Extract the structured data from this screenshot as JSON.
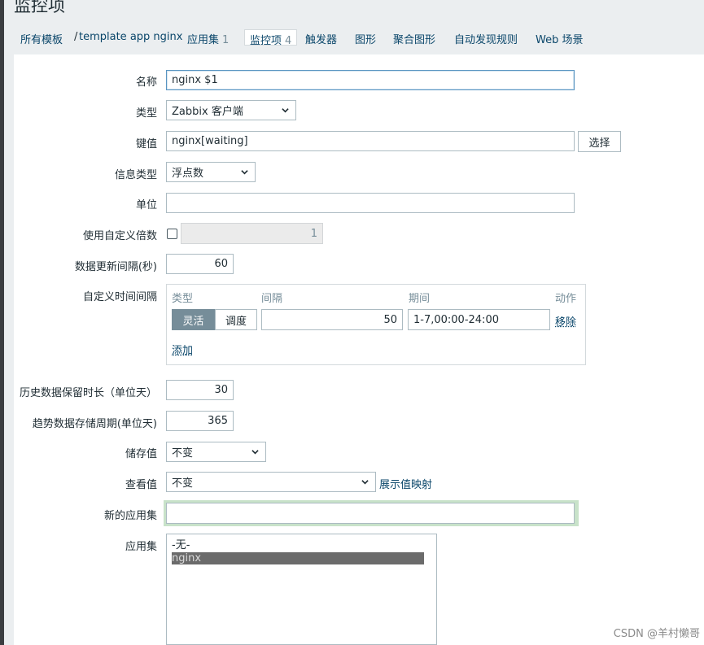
{
  "page": {
    "title": "监控项"
  },
  "nav": {
    "all_templates": "所有模板",
    "separator": "/",
    "template_name": "template app nginx",
    "applications": "应用集",
    "applications_count": "1",
    "items": "监控项",
    "items_count": "4",
    "triggers": "触发器",
    "graphs": "图形",
    "screens": "聚合图形",
    "discovery": "自动发现规则",
    "web": "Web 场景"
  },
  "form": {
    "name_label": "名称",
    "name_value": "nginx $1",
    "type_label": "类型",
    "type_value": "Zabbix 客户端",
    "key_label": "键值",
    "key_value": "nginx[waiting]",
    "select_button": "选择",
    "info_type_label": "信息类型",
    "info_type_value": "浮点数",
    "units_label": "单位",
    "units_value": "",
    "multiplier_label": "使用自定义倍数",
    "multiplier_value": "1",
    "interval_label": "数据更新间隔(秒)",
    "interval_value": "60",
    "custom_intervals_label": "自定义时间间隔",
    "custom_intervals": {
      "col_type": "类型",
      "col_interval": "间隔",
      "col_period": "期间",
      "col_action": "动作",
      "flexible": "灵活",
      "scheduling": "调度",
      "interval_value": "50",
      "period_value": "1-7,00:00-24:00",
      "remove": "移除",
      "add": "添加"
    },
    "history_label": "历史数据保留时长（单位天）",
    "history_value": "30",
    "trends_label": "趋势数据存储周期(单位天)",
    "trends_value": "365",
    "store_label": "储存值",
    "store_value": "不变",
    "show_value_label": "查看值",
    "show_value_value": "不变",
    "show_value_mapping": "展示值映射",
    "new_app_label": "新的应用集",
    "new_app_value": "",
    "apps_label": "应用集",
    "apps_options": [
      "-无-",
      "nginx"
    ]
  },
  "watermark": "CSDN @羊村懒哥"
}
